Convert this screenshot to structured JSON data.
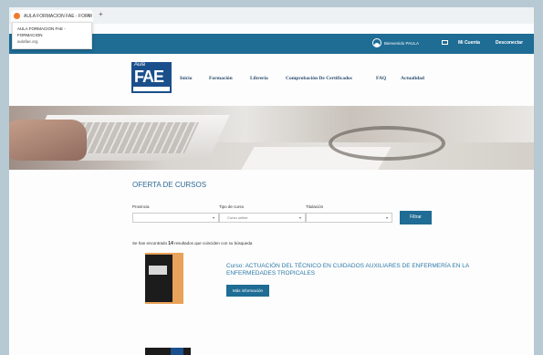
{
  "browser": {
    "tab_title": "AULA FORMACION FAE - FORM",
    "tab_close": "×",
    "new_tab": "+",
    "tooltip_line1": "AULA FORMACION FAE -",
    "tooltip_line2": "FORMACION",
    "tooltip_url": "aulafae.org"
  },
  "topbar": {
    "greeting": "Bienvenido PAULA",
    "account_label": "Mi Cuenta",
    "logout_label": "Desconectar"
  },
  "logo": {
    "aula": "Aula",
    "brand": "FAE"
  },
  "nav": {
    "items": [
      "Inicio",
      "Formación",
      "Libreria",
      "Comprobación De Certificados",
      "FAQ",
      "Actualidad"
    ]
  },
  "section": {
    "title": "OFERTA DE CURSOS"
  },
  "filters": {
    "provincia_label": "Provincia",
    "tipo_label": "Tipo de curso",
    "tipo_value": "Curso online",
    "titulacion_label": "Titulación",
    "arrow": "▾",
    "button": "Filtrar"
  },
  "results": {
    "prefix": "Se han encontrado",
    "count": "14",
    "suffix": "resultados que coinciden con su búsqueda"
  },
  "course": {
    "title": "Curso: ACTUACIÓN DEL TÉCNICO EN CUIDADOS AUXILIARES DE ENFERMERÍA EN LA ENFERMEDADES TROPICALES",
    "button": "Más información"
  },
  "colors": {
    "primary": "#1f6c94",
    "link": "#2e7aa8",
    "logo": "#1b4f8c"
  }
}
